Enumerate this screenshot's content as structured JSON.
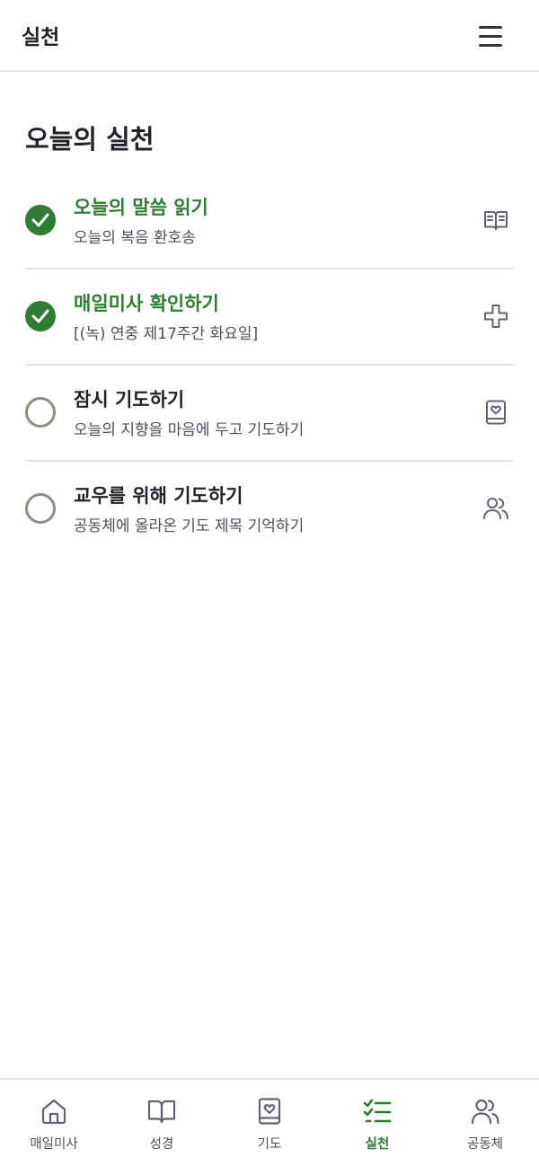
{
  "header": {
    "title": "실천",
    "menu_icon": "hamburger-menu-icon"
  },
  "section": {
    "title": "오늘의 실천"
  },
  "tasks": [
    {
      "title": "오늘의 말씀 읽기",
      "subtitle": "오늘의 복음 환호송",
      "completed": true,
      "icon": "open-book-icon"
    },
    {
      "title": "매일미사 확인하기",
      "subtitle": "[(녹) 연중 제17주간 화요일]",
      "completed": true,
      "icon": "cross-icon"
    },
    {
      "title": "잠시 기도하기",
      "subtitle": "오늘의 지향을 마음에 두고 기도하기",
      "completed": false,
      "icon": "prayer-book-heart-icon"
    },
    {
      "title": "교우를 위해 기도하기",
      "subtitle": "공동체에 올라온 기도 제목 기억하기",
      "completed": false,
      "icon": "people-icon"
    }
  ],
  "bottom_nav": [
    {
      "label": "매일미사",
      "icon": "home-icon",
      "active": false
    },
    {
      "label": "성경",
      "icon": "book-icon",
      "active": false
    },
    {
      "label": "기도",
      "icon": "prayer-book-icon",
      "active": false
    },
    {
      "label": "실천",
      "icon": "checklist-icon",
      "active": true
    },
    {
      "label": "공동체",
      "icon": "community-icon",
      "active": false
    }
  ],
  "colors": {
    "accent": "#2e7d32",
    "text": "#1f2328",
    "subtext": "#4b5058",
    "icon": "#5f6470",
    "divider": "#e3e3e3"
  }
}
